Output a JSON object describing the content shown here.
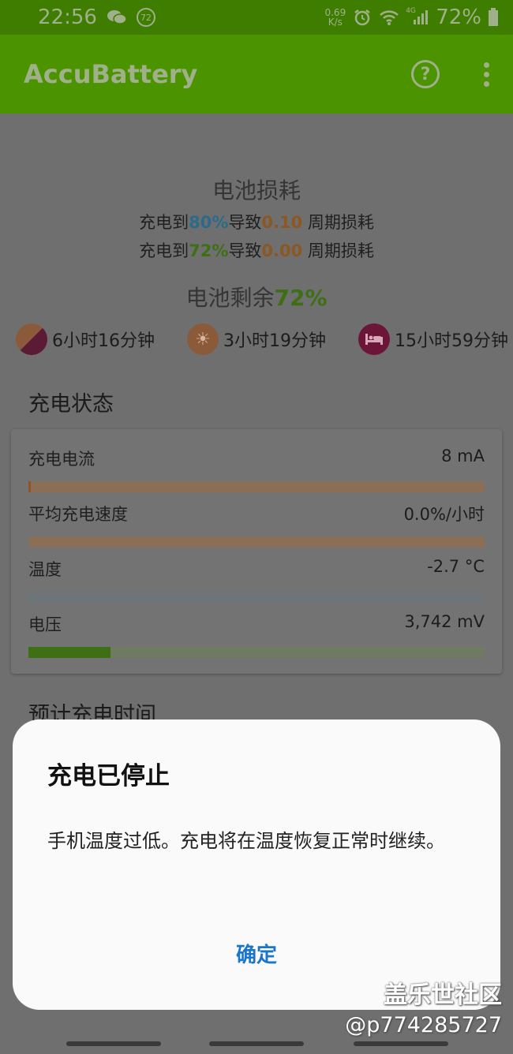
{
  "status_bar": {
    "time": "22:56",
    "notification_count": "72",
    "speed_value": "0.69",
    "speed_unit": "K/s",
    "signal_label": "4G",
    "battery_percent": "72%"
  },
  "app_bar": {
    "title": "AccuBattery"
  },
  "wear": {
    "title": "电池损耗",
    "line1": {
      "prefix": "充电到",
      "percent": "80%",
      "mid": "导致",
      "cycles": "0.10",
      "suffix": " 周期损耗"
    },
    "line2": {
      "prefix": "充电到",
      "percent": "72%",
      "mid": "导致",
      "cycles": "0.00",
      "suffix": " 周期损耗"
    }
  },
  "remaining": {
    "label": "电池剩余",
    "percent": "72%",
    "screen_on_time": "6小时16分钟",
    "active_time": "3小时19分钟",
    "sleep_time": "15小时59分钟"
  },
  "charging_status": {
    "title": "充电状态",
    "rows": [
      {
        "label": "充电电流",
        "value": "8 mA",
        "fill": 0.005,
        "track_color": "#8a6f56",
        "fill_color": "#8a5820"
      },
      {
        "label": "平均充电速度",
        "value": "0.0%/小时",
        "fill": 0.0,
        "track_color": "#8a6f56",
        "fill_color": "#8a5820"
      },
      {
        "label": "温度",
        "value": "-2.7 °C",
        "fill": 0.0,
        "track_color": "#6d7579",
        "fill_color": "#2a6b8a"
      },
      {
        "label": "电压",
        "value": "3,742 mV",
        "fill": 0.18,
        "track_color": "#6e7a62",
        "fill_color": "#3f6f15"
      }
    ]
  },
  "next_section": {
    "title": "预计充电时间"
  },
  "dialog": {
    "title": "充电已停止",
    "message": "手机温度过低。充电将在温度恢复正常时继续。",
    "ok_label": "确定"
  },
  "watermark": {
    "line1": "盖乐世社区",
    "line2": "@p774285727"
  }
}
